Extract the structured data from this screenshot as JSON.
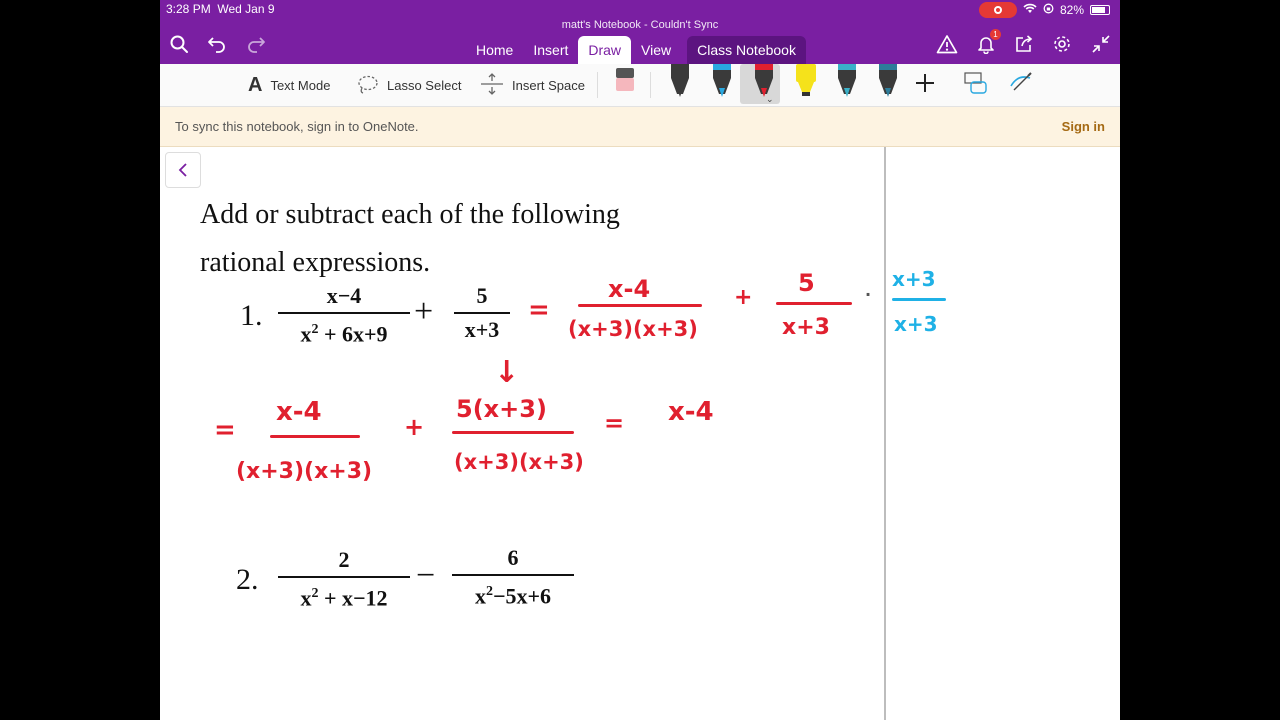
{
  "status": {
    "time": "3:28 PM",
    "date": "Wed Jan 9",
    "battery": "82%",
    "battery_level": 0.82
  },
  "title": "matt's Notebook - Couldn't Sync",
  "tabs": [
    {
      "label": "Home"
    },
    {
      "label": "Insert"
    },
    {
      "label": "Draw"
    },
    {
      "label": "View"
    },
    {
      "label": "Class Notebook"
    }
  ],
  "active_tab": "Draw",
  "notification_count": "1",
  "ribbon": {
    "text_mode": "Text Mode",
    "lasso_select": "Lasso Select",
    "insert_space": "Insert Space",
    "pens": [
      {
        "icon": "pen-icon",
        "color": "#3a3a3a"
      },
      {
        "icon": "pen-icon",
        "color": "#29a8e0"
      },
      {
        "icon": "pen-icon",
        "color": "#e0202f"
      },
      {
        "icon": "highlighter-icon",
        "color": "#f5e21b"
      },
      {
        "icon": "pen-icon",
        "color": "#3ab0c8"
      },
      {
        "icon": "pen-icon",
        "color": "#2e7d9a"
      }
    ]
  },
  "banner": {
    "message": "To sync this notebook, sign in to OneNote.",
    "action": "Sign in"
  },
  "worksheet": {
    "heading_line1": "Add or subtract each of the following",
    "heading_line2": "rational expressions.",
    "p1": {
      "number": "1.",
      "frac1_num": "x−4",
      "frac1_den_a": "x",
      "frac1_den_exp": "2",
      "frac1_den_b": " + 6x+9",
      "op": "+",
      "frac2_num": "5",
      "frac2_den": "x+3"
    },
    "p2": {
      "number": "2.",
      "frac1_num": "2",
      "frac1_den_a": "x",
      "frac1_den_exp": "2",
      "frac1_den_b": " + x−12",
      "op": "−",
      "frac2_num": "6",
      "frac2_den_a": "x",
      "frac2_den_exp": "2",
      "frac2_den_b": "−5x+6"
    }
  },
  "handwriting": {
    "line1": {
      "eq": "=",
      "n1": "x-4",
      "d1": "(x+3)(x+3)",
      "plus": "+",
      "n2": "5",
      "d2": "x+3",
      "dot": "·",
      "n3": "x+3",
      "d3": "x+3"
    },
    "arrow": "↓",
    "line2": {
      "eq": "=",
      "n1": "x-4",
      "d1": "(x+3)(x+3)",
      "plus": "+",
      "n2": "5(x+3)",
      "d2": "(x+3)(x+3)",
      "eq2": "=",
      "result": "x-4"
    }
  },
  "colors": {
    "onenote_purple": "#7a1fa2",
    "ink_red": "#e0202f",
    "ink_blue": "#1fb1e6",
    "banner_bg": "#fdf3e1"
  }
}
